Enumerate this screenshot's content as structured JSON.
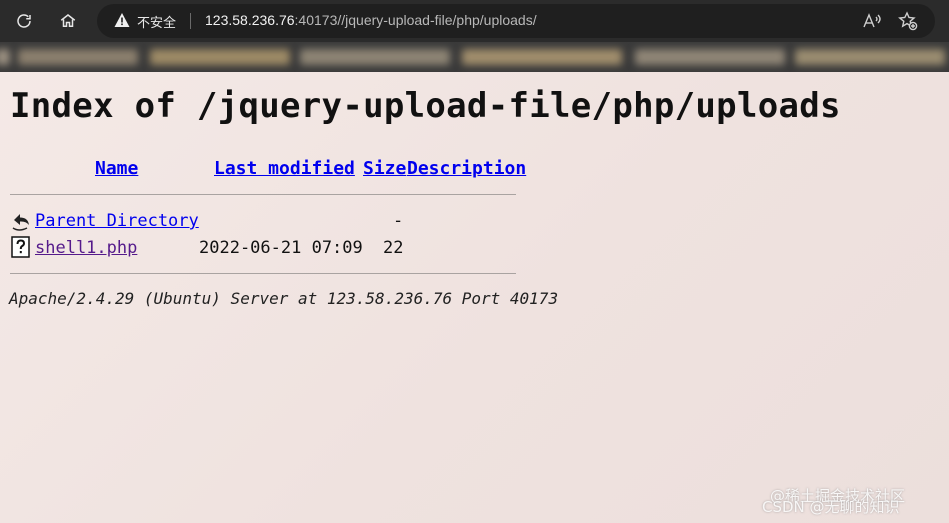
{
  "browser": {
    "security_label": "不安全",
    "url_host": "123.58.236.76",
    "url_rest": ":40173//jquery-upload-file/php/uploads/"
  },
  "listing": {
    "title": "Index of /jquery-upload-file/php/uploads",
    "columns": {
      "name": "Name",
      "last_modified": "Last modified",
      "size": "Size",
      "description": "Description"
    },
    "rows": [
      {
        "name": "Parent Directory",
        "last_modified": "",
        "size": "-",
        "icon": "back-icon"
      },
      {
        "name": "shell1.php",
        "last_modified": "2022-06-21 07:09",
        "size": "22",
        "icon": "unknown-file-icon"
      }
    ],
    "server_signature": "Apache/2.4.29 (Ubuntu) Server at 123.58.236.76 Port 40173"
  },
  "watermark": {
    "line1": "@稀土掘金技术社区",
    "line2": "CSDN @无聊的知识"
  },
  "colors": {
    "link": "#0000ee",
    "visited": "#551a8b",
    "toolbar": "#2b2b2b"
  }
}
